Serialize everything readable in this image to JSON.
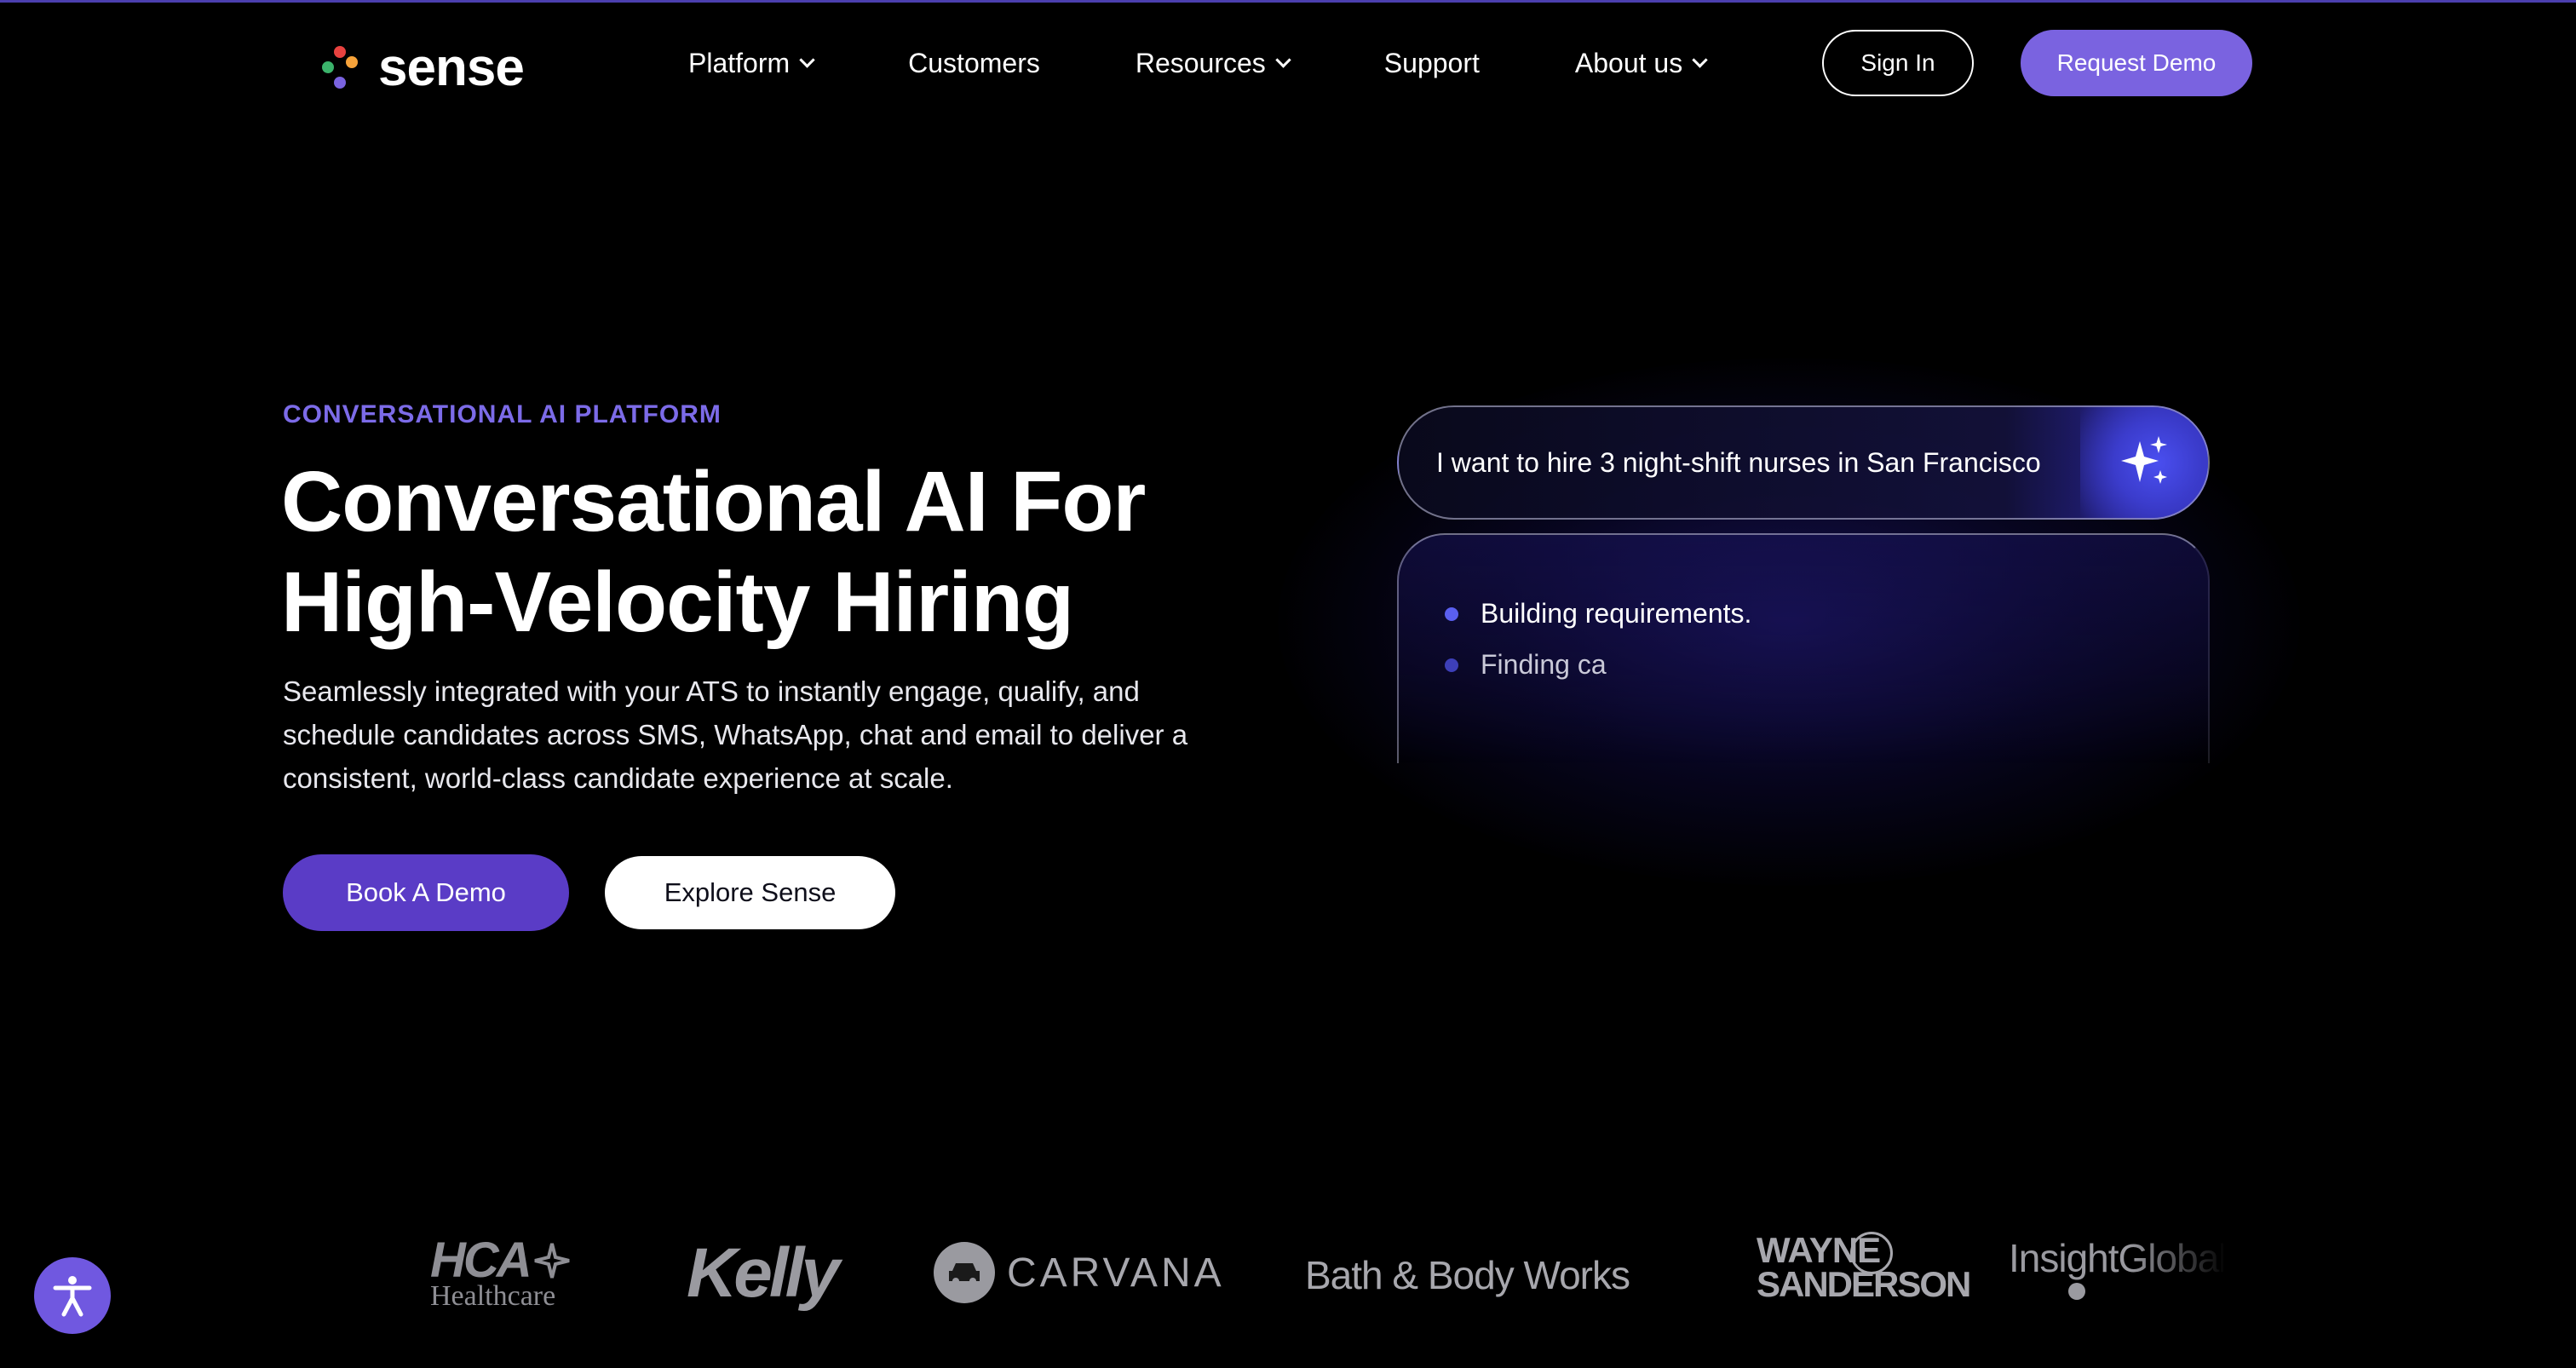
{
  "nav": {
    "logo_text": "sense",
    "logo_dot_colors": [
      "#e8423f",
      "#f7a33a",
      "#3bb36b",
      "#7a63e0"
    ],
    "items": [
      {
        "label": "Platform",
        "has_dropdown": true
      },
      {
        "label": "Customers",
        "has_dropdown": false
      },
      {
        "label": "Resources",
        "has_dropdown": true
      },
      {
        "label": "Support",
        "has_dropdown": false
      },
      {
        "label": "About us",
        "has_dropdown": true
      }
    ],
    "sign_in_label": "Sign In",
    "request_demo_label": "Request Demo"
  },
  "hero": {
    "eyebrow": "CONVERSATIONAL AI PLATFORM",
    "title_line1": "Conversational AI For",
    "title_line2": "High-Velocity Hiring",
    "description": "Seamlessly integrated with your ATS to instantly engage, qualify, and schedule candidates across SMS, WhatsApp, chat and email to deliver a consistent, world-class candidate experience at scale.",
    "book_demo_label": "Book A Demo",
    "explore_label": "Explore Sense"
  },
  "ai_card": {
    "prompt_text": "I want to hire 3 night-shift nurses in San Francisco",
    "sparkle_icon": "sparkle-icon",
    "items": [
      {
        "text": "Building requirements.",
        "dot_color": "#5a5ff0"
      },
      {
        "text": "Finding ca",
        "dot_color": "#3d3fb8"
      }
    ]
  },
  "logos": {
    "hca_line1": "HCA",
    "hca_line2": "Healthcare",
    "kelly": "Kelly",
    "carvana": "CARVANA",
    "bath": "Bath & Body Works",
    "wayne_line1": "WAYNE",
    "wayne_line2": "SANDERSON",
    "insight": "InsightGlobal"
  },
  "accessibility": {
    "icon": "accessibility-icon"
  },
  "colors": {
    "accent": "#7a63e0",
    "accent_dark": "#5a3cc6",
    "eyebrow": "#7c6be8",
    "background": "#000000"
  }
}
